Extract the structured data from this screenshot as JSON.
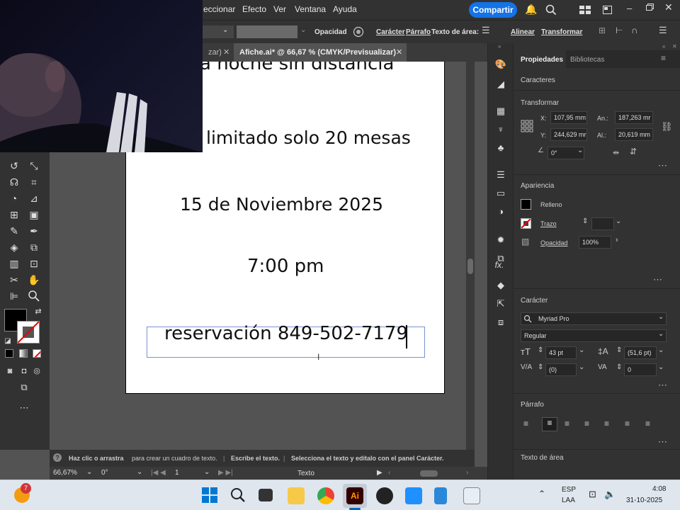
{
  "menubar": {
    "items": [
      "eccionar",
      "Efecto",
      "Ver",
      "Ventana",
      "Ayuda"
    ],
    "share_label": "Compartir"
  },
  "controlbar": {
    "opacity_label": "Opacidad",
    "caracter_label": "Carácter",
    "parrafo_label": "Párrafo",
    "texto_area_label": "Texto de área:",
    "alinear_label": "Alinear",
    "transformar_label": "Transformar"
  },
  "tabs": {
    "tab1_label": "zar)",
    "tab2_label": "Afiche.ai* @ 66,67 % (CMYK/Previsualizar)"
  },
  "artboard": {
    "line1": "a noche sin distancia",
    "line2": "limitado solo 20 mesas",
    "line3": "15 de Noviembre 2025",
    "line4": "7:00 pm",
    "line5": "reservación 849-502-7179"
  },
  "statusbar": {
    "hint1": "Haz clic o arrastra",
    "hint2": "para crear un cuadro de texto.",
    "hint3": "Escribe el texto.",
    "hint4": "Selecciona el texto y edítalo con el panel",
    "hint5": "Carácter."
  },
  "bottombar": {
    "zoom": "66,67%",
    "rotation": "0°",
    "artboard_num": "1",
    "mode_label": "Texto"
  },
  "props": {
    "tab_propiedades": "Propiedades",
    "tab_bibliotecas": "Bibliotecas",
    "caracteres": "Caracteres",
    "transformar": "Transformar",
    "x_label": "X:",
    "x_value": "107,95 mm",
    "y_label": "Y:",
    "y_value": "244,629 mr",
    "w_label": "An.:",
    "w_value": "187,263 mr",
    "h_label": "Al.:",
    "h_value": "20,619 mm",
    "angle_value": "0°",
    "apariencia": "Apariencia",
    "relleno": "Relleno",
    "trazo": "Trazo",
    "opacidad": "Opacidad",
    "opacidad_value": "100%",
    "caracter": "Carácter",
    "font_name": "Myriad Pro",
    "font_style": "Regular",
    "font_size": "43 pt",
    "leading": "(51,6 pt)",
    "kerning": "(0)",
    "tracking": "0",
    "parrafo": "Párrafo",
    "texto_area": "Texto de área"
  },
  "taskbar": {
    "badge_count": "7",
    "lang1": "ESP",
    "lang2": "LAA",
    "time": "4:08",
    "date": "31-10-2025"
  },
  "colors": {
    "accent": "#1473e6",
    "panel_bg": "#323232",
    "canvas_bg": "#535353"
  }
}
